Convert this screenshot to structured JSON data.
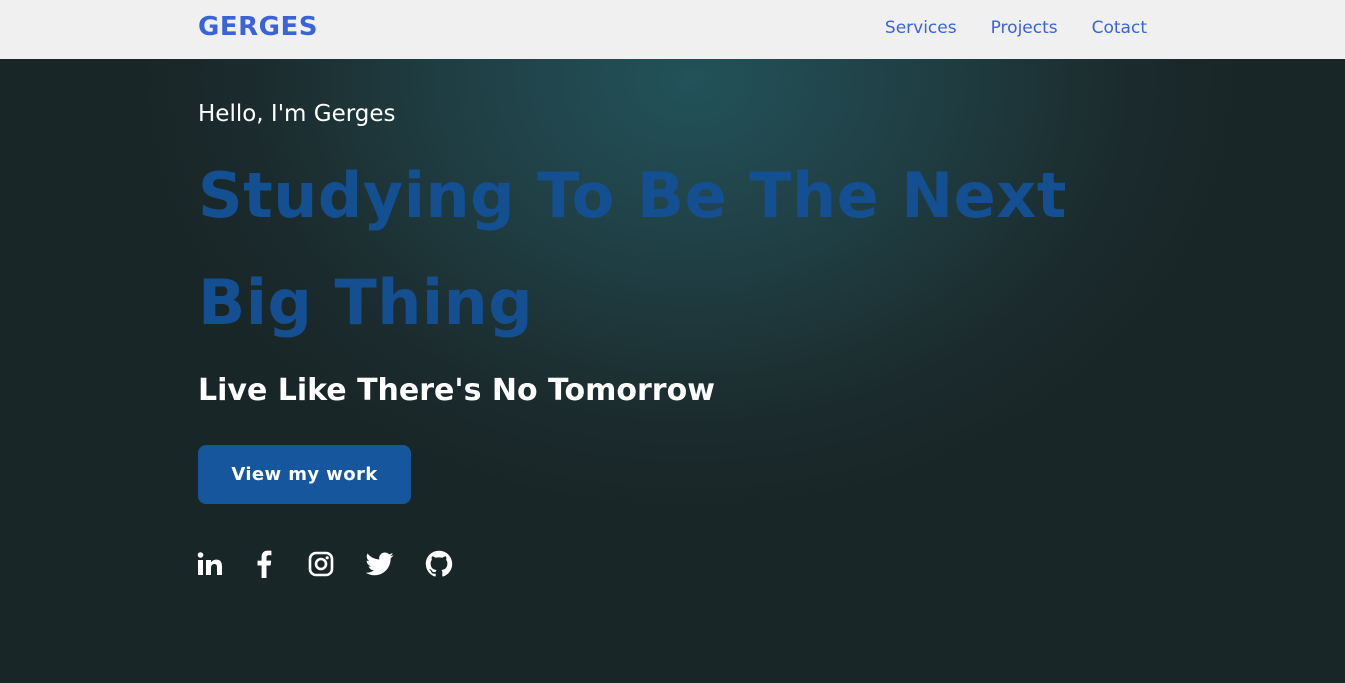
{
  "navbar": {
    "brand": "GERGES",
    "links": [
      {
        "label": "Services"
      },
      {
        "label": "Projects"
      },
      {
        "label": "Cotact"
      }
    ]
  },
  "hero": {
    "greeting": "Hello, I'm Gerges",
    "headline": "Studying To Be The Next Big Thing",
    "tagline": "Live Like There's No Tomorrow",
    "cta_label": "View my work",
    "socials": [
      {
        "icon": "linkedin-icon"
      },
      {
        "icon": "facebook-icon"
      },
      {
        "icon": "instagram-icon"
      },
      {
        "icon": "twitter-icon"
      },
      {
        "icon": "github-icon"
      }
    ]
  },
  "colors": {
    "accent": "#3a63d8",
    "headline": "#144f91",
    "button": "#16569c",
    "navbar_bg": "#f0f0f0",
    "hero_bg": "#1b2a2c"
  }
}
